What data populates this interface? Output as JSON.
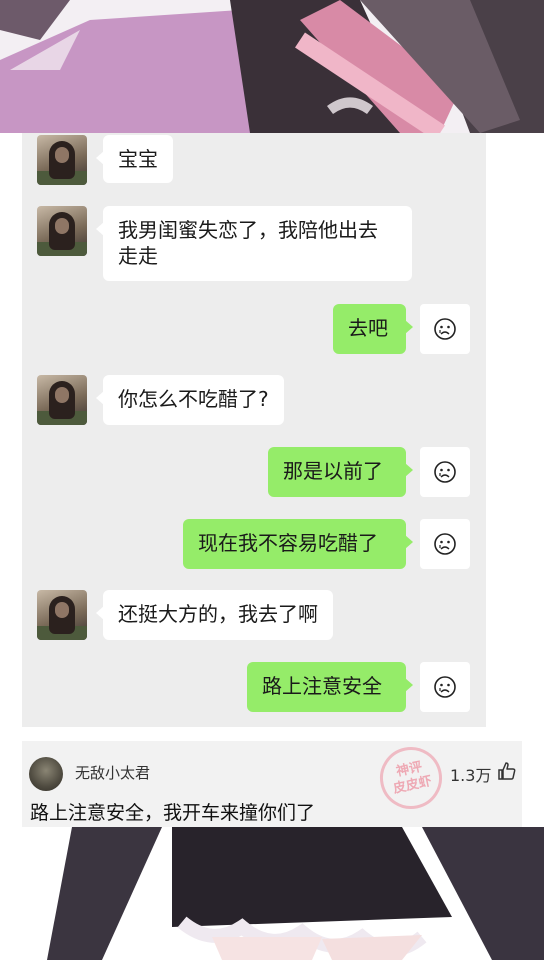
{
  "colors": {
    "chat_background": "#ededed",
    "incoming_bubble": "#ffffff",
    "outgoing_bubble": "#95ec69",
    "comment_background": "#f2f2f2"
  },
  "chat": {
    "messages": [
      {
        "side": "left",
        "text": "宝宝"
      },
      {
        "side": "left",
        "text": "我男闺蜜失恋了，我陪他出去走走"
      },
      {
        "side": "right",
        "text": "去吧"
      },
      {
        "side": "left",
        "text": "你怎么不吃醋了?"
      },
      {
        "side": "right",
        "text": "那是以前了"
      },
      {
        "side": "right",
        "text": "现在我不容易吃醋了"
      },
      {
        "side": "left",
        "text": "还挺大方的，我去了啊"
      },
      {
        "side": "right",
        "text": "路上注意安全"
      }
    ],
    "left_avatar_icon": "girl-photo-avatar",
    "right_avatar_icon": "crying-face-sticker-icon"
  },
  "comment": {
    "username": "无敌小太君",
    "likes": "1.3万",
    "text": "路上注意安全，我开车来撞你们了",
    "stamp_line1": "神评",
    "stamp_line2": "皮皮虾",
    "like_icon": "thumbs-up-icon"
  }
}
